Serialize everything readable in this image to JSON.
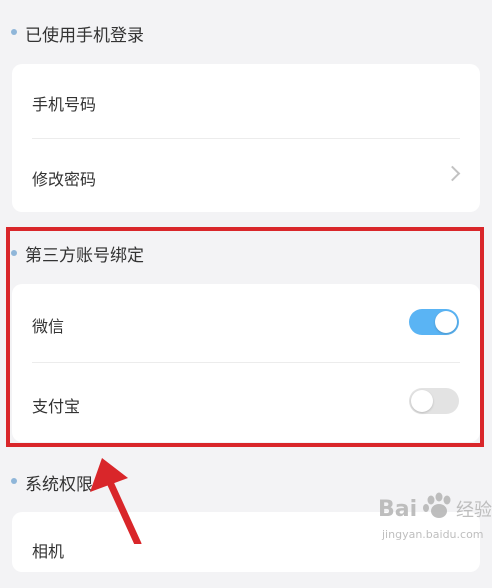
{
  "login_section": {
    "title": "已使用手机登录",
    "rows": [
      {
        "label": "手机号码"
      },
      {
        "label": "修改密码"
      }
    ]
  },
  "third_party_section": {
    "title": "第三方账号绑定",
    "rows": [
      {
        "label": "微信",
        "toggle_on": true
      },
      {
        "label": "支付宝",
        "toggle_on": false
      }
    ]
  },
  "system_section": {
    "title": "系统权限",
    "rows": [
      {
        "label": "相机"
      }
    ]
  },
  "colors": {
    "accent": "#5ab4f4",
    "highlight": "#d9262a",
    "background": "#f3f3f5"
  },
  "watermark": {
    "text_main": "Bai",
    "text_tail": "经验",
    "subtext": "jingyan.baidu.com"
  }
}
